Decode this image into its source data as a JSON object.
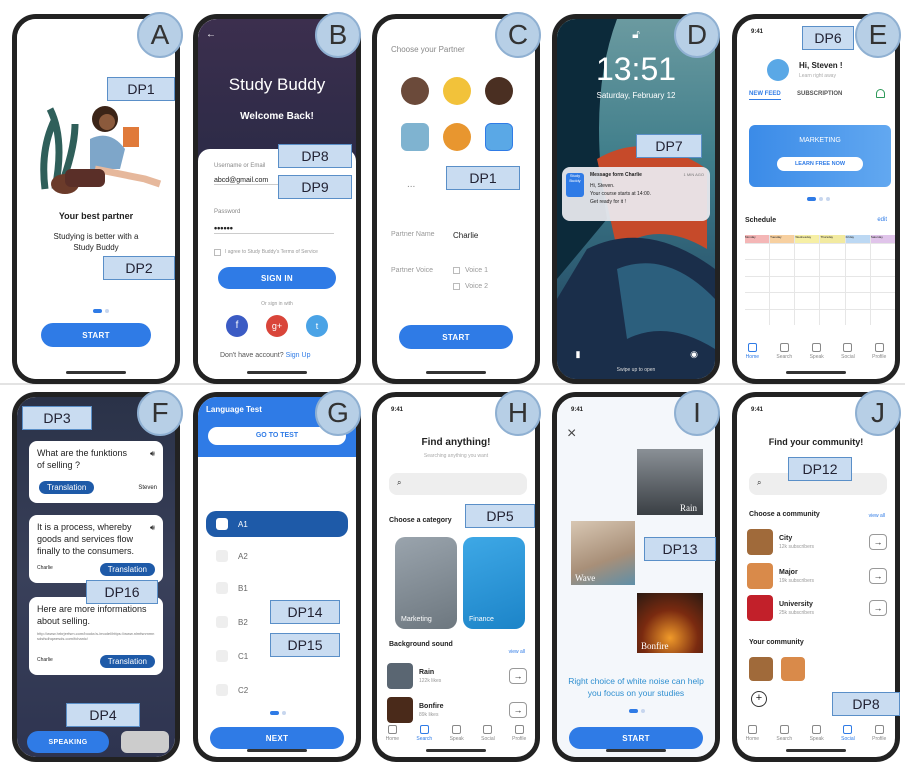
{
  "labels": {
    "A": "A",
    "B": "B",
    "C": "C",
    "D": "D",
    "E": "E",
    "F": "F",
    "G": "G",
    "H": "H",
    "I": "I",
    "J": "J"
  },
  "dp": {
    "a1": "DP1",
    "a2": "DP2",
    "b8": "DP8",
    "b9": "DP9",
    "c1": "DP1",
    "d7": "DP7",
    "e6": "DP6",
    "f3": "DP3",
    "f16": "DP16",
    "f4": "DP4",
    "g14": "DP14",
    "g15": "DP15",
    "h5": "DP5",
    "i13": "DP13",
    "j12": "DP12",
    "j8": "DP8"
  },
  "colors": {
    "accent": "#2f7be6",
    "dp_fill": "#c9dcf1",
    "dp_border": "#5a8fc8",
    "letter": "#b7cfe6"
  },
  "a": {
    "title": "Your best partner",
    "sub": "Studying is better with a Study Buddy",
    "start": "START"
  },
  "b": {
    "title": "Study Buddy",
    "welcome": "Welcome Back!",
    "user_label": "Username or Email",
    "user_value": "abcd@gmail.com",
    "pw_label": "Password",
    "pw_value": "••••••",
    "terms": "I agree to Study Buddy's Terms of Service",
    "signin": "SIGN IN",
    "or": "Or sign in with",
    "fb": "f",
    "gp": "g+",
    "tw": "t",
    "noacc": "Don't have account?",
    "signup": "Sign Up"
  },
  "c": {
    "title": "Choose your Partner",
    "more": "...",
    "name_label": "Partner Name",
    "name_value": "Charlie",
    "voice_label": "Partner Voice",
    "voice1": "Voice 1",
    "voice2": "Voice 2",
    "start": "START"
  },
  "d": {
    "time": "13:51",
    "date": "Saturday, February 12",
    "notif_app": "Study Buddy",
    "notif_title": "Message form Charlie",
    "notif_when": "1 MIN AGO",
    "notif_l1": "Hi, Steven.",
    "notif_l2": "Your course starts at 14:00.",
    "notif_l3": "Get ready for it !",
    "swipe": "Swipe up to open"
  },
  "e": {
    "status_time": "9:41",
    "hi": "Hi, Steven !",
    "sub": "Learn right away",
    "tab1": "NEW FEED",
    "tab2": "SUBSCRIPTION",
    "banner": "MARKETING",
    "learn": "LEARN FREE NOW",
    "schedule": "Schedule",
    "edit": "edit",
    "days": [
      "Monday",
      "Tuesday",
      "Wednesday",
      "Thursday",
      "Friday",
      "Saturday"
    ],
    "tabs": [
      "Home",
      "Search",
      "Speak",
      "Social",
      "Profile"
    ]
  },
  "f": {
    "q": "What are the funktions of selling ?",
    "translation": "Translation",
    "user": "Steven",
    "a": "It is a process, whereby goods and services flow finally to the consumers.",
    "see": "See more",
    "charlie": "Charlie",
    "more": "Here are more informations about selling.",
    "link": "http://www.hrbrjerfsm.com/bookr/a-/model/https://www.nlmfsnmmnsdsfsdhqwesds.com/fchanic/",
    "speaking": "SPEAKING"
  },
  "g": {
    "title": "Language Test",
    "go": "GO TO TEST",
    "opts": [
      "A1",
      "A2",
      "B1",
      "B2",
      "C1",
      "C2"
    ],
    "next": "NEXT"
  },
  "h": {
    "status_time": "9:41",
    "title": "Find anything!",
    "sub": "Searching anything you want",
    "cat": "Choose a category",
    "c1": "Marketing",
    "c2": "Finance",
    "bg": "Background sound",
    "viewall": "view all",
    "s1": "Rain",
    "s1n": "122k likes",
    "s2": "Bonfire",
    "s2n": "89k likes",
    "tabs": [
      "Home",
      "Search",
      "Speak",
      "Social",
      "Profile"
    ]
  },
  "i": {
    "status_time": "9:41",
    "close": "×",
    "rain": "Rain",
    "wave": "Wave",
    "bonfire": "Bonfire",
    "text": "Right choice of white noise can help you focus on your studies",
    "start": "START"
  },
  "j": {
    "status_time": "9:41",
    "title": "Find your community!",
    "choose": "Choose a community",
    "viewall": "view all",
    "c1": "City",
    "c1n": "12k subscribers",
    "c2": "Major",
    "c2n": "19k subscribers",
    "c3": "University",
    "c3n": "25k subscribers",
    "yours": "Your community",
    "plus": "+",
    "tabs": [
      "Home",
      "Search",
      "Speak",
      "Social",
      "Profile"
    ]
  }
}
